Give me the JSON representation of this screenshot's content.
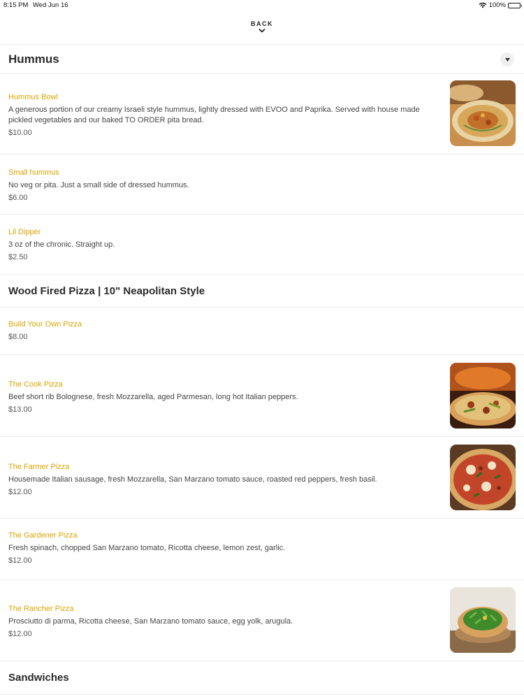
{
  "status": {
    "time": "8:15 PM",
    "date": "Wed Jun 16",
    "battery": "100%"
  },
  "nav": {
    "back_label": "BACK"
  },
  "sections": [
    {
      "title": "Hummus",
      "items": [
        {
          "name": "Hummus Bowl",
          "description": "A generous portion of our creamy Israeli style hummus, lightly dressed with EVOO and Paprika. Served with house made pickled vegetables and our baked TO ORDER pita bread.",
          "price": "$10.00",
          "image": "hummus-bowl-photo"
        },
        {
          "name": "Small hummus",
          "description": "No veg or pita. Just a small side of dressed hummus.",
          "price": "$6.00"
        },
        {
          "name": "Lil Dipper",
          "description": "3 oz of the chronic. Straight up.",
          "price": "$2.50"
        }
      ]
    },
    {
      "title": "Wood Fired Pizza | 10\" Neapolitan Style",
      "items": [
        {
          "name": "Build Your Own Pizza",
          "price": "$8.00"
        },
        {
          "name": "The Cook Pizza",
          "description": "Beef short rib Bolognese, fresh Mozzarella, aged Parmesan, long hot Italian peppers.",
          "price": "$13.00",
          "image": "cook-pizza-photo"
        },
        {
          "name": "The Farmer Pizza",
          "description": "Housemade Italian sausage, fresh Mozzarella, San Marzano tomato sauce, roasted red peppers, fresh basil.",
          "price": "$12.00",
          "image": "farmer-pizza-photo"
        },
        {
          "name": "The Gardener Pizza",
          "description": "Fresh spinach, chopped San Marzano tomato, Ricotta cheese, lemon zest, garlic.",
          "price": "$12.00"
        },
        {
          "name": "The Rancher Pizza",
          "description": "Prosciutto di parma, Ricotta cheese, San Marzano tomato sauce, egg yolk, arugula.",
          "price": "$12.00",
          "image": "rancher-pizza-photo"
        }
      ]
    },
    {
      "title": "Sandwiches"
    }
  ],
  "colors": {
    "accent": "#d9a400",
    "divider": "#ececec",
    "text": "#2b2b2b"
  }
}
